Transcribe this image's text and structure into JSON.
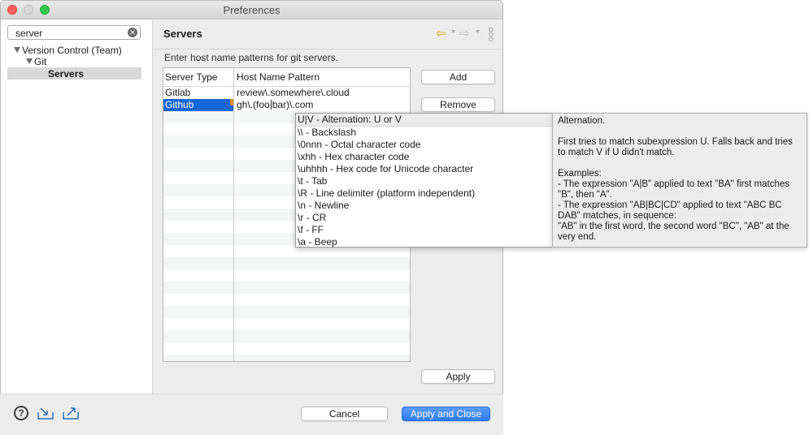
{
  "window": {
    "title": "Preferences"
  },
  "search": {
    "value": "server"
  },
  "tree": [
    {
      "label": "Version Control (Team)"
    },
    {
      "label": "Git"
    },
    {
      "label": "Servers"
    }
  ],
  "page": {
    "title": "Servers",
    "description": "Enter host name patterns for git servers."
  },
  "table": {
    "headers": [
      "Server Type",
      "Host Name Pattern"
    ],
    "rows": [
      {
        "type": "Gitlab",
        "pattern": "review\\.somewhere\\.cloud"
      },
      {
        "type": "Github",
        "pattern_before": "gh\\.(foo",
        "pattern_after": "bar)\\.com"
      }
    ]
  },
  "buttons": {
    "add": "Add",
    "remove": "Remove",
    "apply": "Apply",
    "cancel": "Cancel",
    "apply_close": "Apply and Close"
  },
  "popup": {
    "items": [
      "U|V - Alternation: U or V",
      "\\\\ - Backslash",
      "\\0nnn - Octal character code",
      "\\xhh - Hex character code",
      "\\uhhhh - Hex code for Unicode character",
      "\\t - Tab",
      "\\R - Line delimiter (platform independent)",
      "\\n - Newline",
      "\\r - CR",
      "\\f - FF",
      "\\a - Beep"
    ]
  },
  "info": {
    "title": "Alternation.",
    "body": "First tries to match subexpression U. Falls back and tries to match V if U didn't match.",
    "examples_label": "Examples:",
    "example1": "- The expression \"A|B\" applied to text \"BA\" first matches \"B\", then \"A\".",
    "example2": "- The expression \"AB|BC|CD\" applied to text \"ABC BC DAB\" matches, in sequence:",
    "example3": "\"AB\" in the first word, the second word \"BC\", \"AB\" at the very end."
  },
  "icons": {
    "back": "back-arrow-icon",
    "forward": "forward-arrow-icon",
    "menu": "view-menu-icon",
    "help": "help-icon",
    "import": "import-icon",
    "export": "export-icon",
    "clear": "clear-search-icon"
  },
  "colors": {
    "accent": "#2f7cf5",
    "selection": "#1566d8",
    "nav_back": "#d8a31a"
  }
}
